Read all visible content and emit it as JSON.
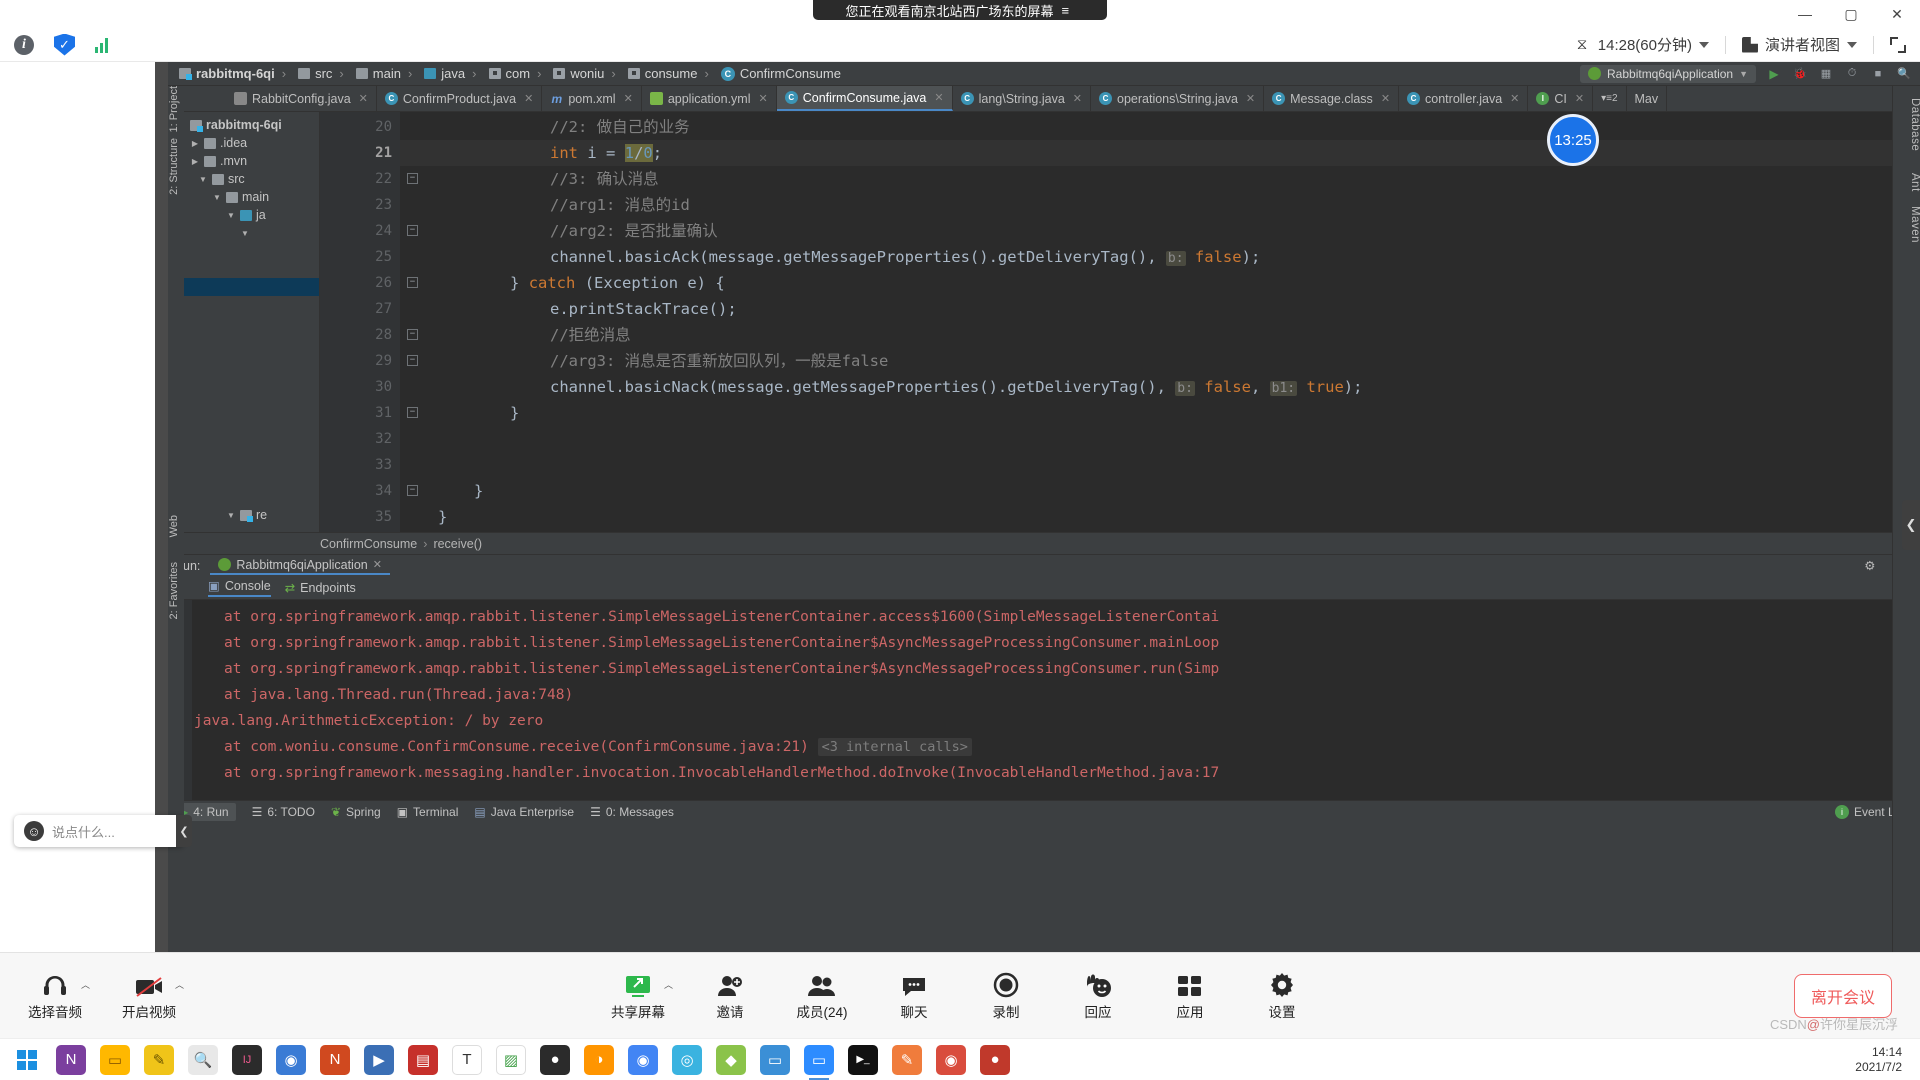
{
  "share_banner": {
    "text": "您正在观看南京北站西广场东的屏幕",
    "menu_icon": "hamburger-icon"
  },
  "window_controls": {
    "minimize": "—",
    "maximize": "▢",
    "close": "✕"
  },
  "zoom_topbar": {
    "info_icon": "info-icon",
    "shield_icon": "security-shield-icon",
    "signal_icon": "signal-bars-icon",
    "timer_icon": "hourglass-icon",
    "timer_label": "14:28(60分钟)",
    "view_icon": "layout-icon",
    "view_label": "演讲者视图",
    "fullscreen_icon": "fullscreen-icon"
  },
  "timer_bubble": {
    "value": "13:25"
  },
  "ide": {
    "breadcrumb": [
      "rabbitmq-6qi",
      "src",
      "main",
      "java",
      "com",
      "woniu",
      "consume",
      "ConfirmConsume"
    ],
    "run_config": "Rabbitmq6qiApplication",
    "tabs": [
      {
        "label": "RabbitConfig.java",
        "icon": "settings-file-icon",
        "active": false
      },
      {
        "label": "ConfirmProduct.java",
        "icon": "java-class-icon",
        "active": false
      },
      {
        "label": "pom.xml",
        "icon": "maven-icon",
        "active": false
      },
      {
        "label": "application.yml",
        "icon": "yaml-icon",
        "active": false
      },
      {
        "label": "ConfirmConsume.java",
        "icon": "java-class-icon",
        "active": true
      },
      {
        "label": "lang\\String.java",
        "icon": "java-lib-icon",
        "active": false
      },
      {
        "label": "operations\\String.java",
        "icon": "java-lib-icon",
        "active": false
      },
      {
        "label": "Message.class",
        "icon": "java-lib-icon",
        "active": false
      },
      {
        "label": "controller.java",
        "icon": "java-class-icon",
        "active": false
      },
      {
        "label": "CI",
        "icon": "info-class-icon",
        "active": false
      }
    ],
    "project_tree": [
      {
        "label": "rabbitmq-6qi",
        "depth": 0,
        "twisty": "down",
        "icon": "project-module-icon"
      },
      {
        "label": ".idea",
        "depth": 1,
        "twisty": "right",
        "icon": "folder-icon"
      },
      {
        "label": ".mvn",
        "depth": 1,
        "twisty": "right",
        "icon": "folder-icon"
      },
      {
        "label": "src",
        "depth": 1,
        "twisty": "down",
        "icon": "folder-icon"
      },
      {
        "label": "main",
        "depth": 2,
        "twisty": "down",
        "icon": "folder-icon"
      },
      {
        "label": "ja",
        "depth": 3,
        "twisty": "down",
        "icon": "source-folder-icon"
      },
      {
        "label": "",
        "depth": 4,
        "twisty": "down",
        "icon": ""
      },
      {
        "label": "re",
        "depth": 3,
        "twisty": "down",
        "icon": "resources-folder-icon"
      }
    ],
    "code_lines": [
      {
        "num": "20",
        "text": "//2: 做自己的业务",
        "kind": "comment",
        "fold": false,
        "current": false
      },
      {
        "num": "21",
        "text": "int i = 1/0;",
        "kind": "code-divzero",
        "fold": false,
        "current": true
      },
      {
        "num": "22",
        "text": "//3: 确认消息",
        "kind": "comment",
        "fold": true,
        "current": false
      },
      {
        "num": "23",
        "text": "//arg1: 消息的id",
        "kind": "comment",
        "fold": false,
        "current": false
      },
      {
        "num": "24",
        "text": "//arg2: 是否批量确认",
        "kind": "comment",
        "fold": true,
        "current": false
      },
      {
        "num": "25",
        "text": "channel.basicAck(message.getMessageProperties().getDeliveryTag(), b: false);",
        "kind": "code-ack",
        "fold": false,
        "current": false
      },
      {
        "num": "26",
        "text": "} catch (Exception e) {",
        "kind": "code-catch",
        "fold": true,
        "current": false
      },
      {
        "num": "27",
        "text": "e.printStackTrace();",
        "kind": "code-pst",
        "fold": false,
        "current": false
      },
      {
        "num": "28",
        "text": "//拒绝消息",
        "kind": "comment",
        "fold": true,
        "current": false
      },
      {
        "num": "29",
        "text": "//arg3: 消息是否重新放回队列，一般是false",
        "kind": "comment",
        "fold": true,
        "current": false
      },
      {
        "num": "30",
        "text": "channel.basicNack(message.getMessageProperties().getDeliveryTag(), b: false, b1: true);",
        "kind": "code-nack",
        "fold": false,
        "current": false
      },
      {
        "num": "31",
        "text": "}",
        "kind": "code-brace2",
        "fold": true,
        "current": false
      },
      {
        "num": "32",
        "text": "",
        "kind": "blank",
        "fold": false,
        "current": false
      },
      {
        "num": "33",
        "text": "",
        "kind": "blank",
        "fold": false,
        "current": false
      },
      {
        "num": "34",
        "text": "}",
        "kind": "code-brace1",
        "fold": true,
        "current": false
      },
      {
        "num": "35",
        "text": "}",
        "kind": "code-brace0",
        "fold": false,
        "current": false
      }
    ],
    "editor_breadcrumb": [
      "ConfirmConsume",
      "receive()"
    ],
    "run_panel": {
      "run_label": "Run:",
      "config_name": "Rabbitmq6qiApplication",
      "tabs": [
        {
          "label": "Console",
          "icon": "console-icon",
          "active": true
        },
        {
          "label": "Endpoints",
          "icon": "endpoints-icon",
          "active": false
        }
      ],
      "console_lines": [
        {
          "text": "at org.springframework.amqp.rabbit.listener.SimpleMessageListenerContainer.access$1600(SimpleMessageListenerContai",
          "internal": ""
        },
        {
          "text": "at org.springframework.amqp.rabbit.listener.SimpleMessageListenerContainer$AsyncMessageProcessingConsumer.mainLoop",
          "internal": ""
        },
        {
          "text": "at org.springframework.amqp.rabbit.listener.SimpleMessageListenerContainer$AsyncMessageProcessingConsumer.run(Simp",
          "internal": ""
        },
        {
          "text": "at java.lang.Thread.run(Thread.java:748)",
          "internal": ""
        },
        {
          "text": "java.lang.ArithmeticException: / by zero",
          "internal": "",
          "noindent": true
        },
        {
          "text": "at com.woniu.consume.ConfirmConsume.receive(ConfirmConsume.java:21)",
          "internal": "<3 internal calls>"
        },
        {
          "text": "at org.springframework.messaging.handler.invocation.InvocableHandlerMethod.doInvoke(InvocableHandlerMethod.java:17",
          "internal": ""
        }
      ]
    },
    "status_bar": [
      {
        "label": "4: Run",
        "icon": "run-icon",
        "active": true
      },
      {
        "label": "6: TODO",
        "icon": "todo-icon",
        "active": false
      },
      {
        "label": "Spring",
        "icon": "spring-leaf-icon",
        "active": false
      },
      {
        "label": "Terminal",
        "icon": "terminal-icon",
        "active": false
      },
      {
        "label": "Java Enterprise",
        "icon": "java-enterprise-icon",
        "active": false
      },
      {
        "label": "0: Messages",
        "icon": "messages-icon",
        "active": false
      }
    ],
    "event_log": "Event Log",
    "right_strips": [
      "Database",
      "Ant",
      "Maven"
    ],
    "left_strips": [
      "1: Project",
      "2: Structure",
      "Web",
      "2: Favorites"
    ]
  },
  "chat_float": {
    "placeholder": "说点什么...",
    "avatar_icon": "smiley-icon",
    "collapse_icon": "chevron-left-icon"
  },
  "meeting_toolbar": {
    "left": [
      {
        "label": "选择音频",
        "icon": "headset-icon",
        "caret": true
      },
      {
        "label": "开启视频",
        "icon": "video-off-icon",
        "caret": true
      }
    ],
    "center": [
      {
        "label": "共享屏幕",
        "icon": "share-screen-icon",
        "caret": true
      },
      {
        "label": "邀请",
        "icon": "invite-icon",
        "caret": false
      },
      {
        "label": "成员(24)",
        "icon": "participants-icon",
        "caret": false
      },
      {
        "label": "聊天",
        "icon": "chat-icon",
        "caret": false
      },
      {
        "label": "录制",
        "icon": "record-icon",
        "caret": false
      },
      {
        "label": "回应",
        "icon": "reaction-icon",
        "caret": false
      },
      {
        "label": "应用",
        "icon": "apps-icon",
        "caret": false
      },
      {
        "label": "设置",
        "icon": "settings-gear-icon",
        "caret": false
      }
    ],
    "leave_button": "离开会议"
  },
  "taskbar": {
    "items": [
      {
        "name": "start-windows-icon",
        "color": "#1b8fe0",
        "glyph": ""
      },
      {
        "name": "onenote-icon",
        "color": "#7b3f9e",
        "glyph": "N"
      },
      {
        "name": "file-explorer-icon",
        "color": "#ffb800",
        "glyph": "📁"
      },
      {
        "name": "notepad-icon",
        "color": "#f0c419",
        "glyph": "✎"
      },
      {
        "name": "everything-search-icon",
        "color": "#e8e8e8",
        "glyph": "🔍"
      },
      {
        "name": "intellij-idea-icon",
        "color": "#2b2b2b",
        "glyph": "IJ"
      },
      {
        "name": "browser-icon",
        "color": "#3a7bd5",
        "glyph": "◉"
      },
      {
        "name": "navicat-icon",
        "color": "#d0491f",
        "glyph": "N"
      },
      {
        "name": "terminal-blue-icon",
        "color": "#3b6fb5",
        "glyph": "▶"
      },
      {
        "name": "redis-icon",
        "color": "#c6302b",
        "glyph": "▤"
      },
      {
        "name": "typora-icon",
        "color": "#ffffff",
        "glyph": "T"
      },
      {
        "name": "chart-app-icon",
        "color": "#3f9e45",
        "glyph": "📈"
      },
      {
        "name": "git-cat-icon",
        "color": "#2b2b2b",
        "glyph": "🐱"
      },
      {
        "name": "firefox-icon",
        "color": "#ff9500",
        "glyph": "◑"
      },
      {
        "name": "chrome-icon",
        "color": "#4285f4",
        "glyph": "◉"
      },
      {
        "name": "edge-icon",
        "color": "#3ab3e0",
        "glyph": "◎"
      },
      {
        "name": "xmind-icon",
        "color": "#8bc34a",
        "glyph": "◆"
      },
      {
        "name": "wechat-work-icon",
        "color": "#3b8fd6",
        "glyph": "💬"
      },
      {
        "name": "zoom-meeting-icon",
        "color": "#2d8cff",
        "glyph": "▭"
      },
      {
        "name": "cmd-icon",
        "color": "#111111",
        "glyph": "▶_"
      },
      {
        "name": "pdf-reader-icon",
        "color": "#f07c3c",
        "glyph": "✎"
      },
      {
        "name": "chrome-canary-icon",
        "color": "#d94c3d",
        "glyph": "◉"
      },
      {
        "name": "recorder-icon",
        "color": "#c0392b",
        "glyph": "●"
      }
    ],
    "clock_time": "14:14",
    "clock_date": "2021/7/2"
  },
  "watermark": {
    "prefix": "CSDN",
    "highlight": "@",
    "suffix": "许你星辰沉浮"
  }
}
